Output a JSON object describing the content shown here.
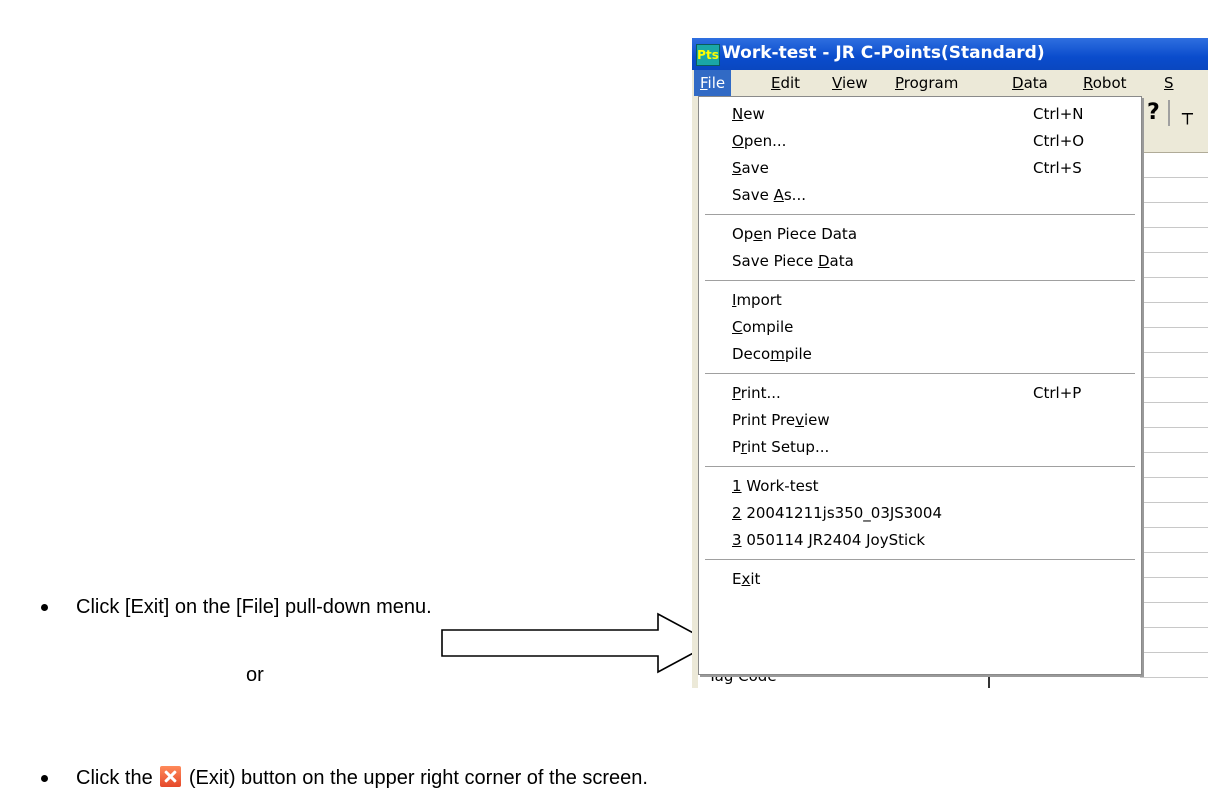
{
  "window": {
    "title": "Work-test - JR C-Points(Standard)",
    "app_icon_text": "Pts"
  },
  "menubar": [
    {
      "pre": "",
      "key": "F",
      "post": "ile",
      "active": true
    },
    {
      "pre": "",
      "key": "E",
      "post": "dit",
      "active": false
    },
    {
      "pre": "",
      "key": "V",
      "post": "iew",
      "active": false
    },
    {
      "pre": "",
      "key": "P",
      "post": "rogram",
      "active": false
    },
    {
      "pre": "",
      "key": "D",
      "post": "ata",
      "active": false
    },
    {
      "pre": "",
      "key": "R",
      "post": "obot",
      "active": false
    },
    {
      "pre": "",
      "key": "S",
      "post": "",
      "active": false
    }
  ],
  "file_menu": [
    [
      {
        "pre": "",
        "key": "N",
        "post": "ew",
        "shortcut": "Ctrl+N"
      },
      {
        "pre": "",
        "key": "O",
        "post": "pen...",
        "shortcut": "Ctrl+O"
      },
      {
        "pre": "",
        "key": "S",
        "post": "ave",
        "shortcut": "Ctrl+S"
      },
      {
        "pre": "Save ",
        "key": "A",
        "post": "s...",
        "shortcut": ""
      }
    ],
    [
      {
        "pre": "Op",
        "key": "e",
        "post": "n Piece Data",
        "shortcut": ""
      },
      {
        "pre": "Save Piece ",
        "key": "D",
        "post": "ata",
        "shortcut": ""
      }
    ],
    [
      {
        "pre": "",
        "key": "I",
        "post": "mport",
        "shortcut": ""
      },
      {
        "pre": "",
        "key": "C",
        "post": "ompile",
        "shortcut": ""
      },
      {
        "pre": "Deco",
        "key": "m",
        "post": "pile",
        "shortcut": ""
      }
    ],
    [
      {
        "pre": "",
        "key": "P",
        "post": "rint...",
        "shortcut": "Ctrl+P"
      },
      {
        "pre": "Print Pre",
        "key": "v",
        "post": "iew",
        "shortcut": ""
      },
      {
        "pre": "P",
        "key": "r",
        "post": "int Setup...",
        "shortcut": ""
      }
    ],
    [
      {
        "pre": "",
        "key": "1",
        "post": " Work-test",
        "shortcut": ""
      },
      {
        "pre": "",
        "key": "2",
        "post": " 20041211js350_03JS3004",
        "shortcut": ""
      },
      {
        "pre": "",
        "key": "3",
        "post": " 050114 JR2404 JoyStick",
        "shortcut": ""
      }
    ],
    [
      {
        "pre": "E",
        "key": "x",
        "post": "it",
        "shortcut": ""
      }
    ]
  ],
  "background": {
    "toolbar_help_glyph": "?",
    "toolbar_partial_glyph": "┬",
    "bottom_cell_text": "Tag Code"
  },
  "instructions": {
    "bullet1": "Click [Exit] on the [File] pull-down menu.",
    "or": "or",
    "bullet2_before": "Click the",
    "bullet2_after": "(Exit) button on the upper right corner of the screen.",
    "exit_icon": "close-icon"
  },
  "colors": {
    "menu_highlight": "#316ac5",
    "titlebar": "#0a4ccc",
    "exit_icon": "#e5482a"
  }
}
